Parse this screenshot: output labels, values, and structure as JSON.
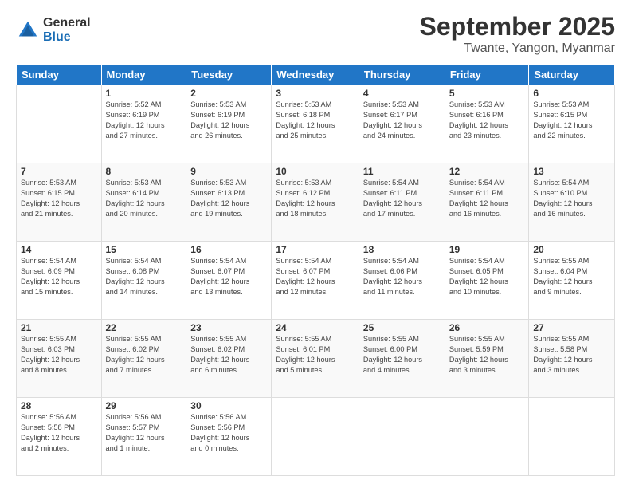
{
  "logo": {
    "general": "General",
    "blue": "Blue"
  },
  "header": {
    "title": "September 2025",
    "location": "Twante, Yangon, Myanmar"
  },
  "days_of_week": [
    "Sunday",
    "Monday",
    "Tuesday",
    "Wednesday",
    "Thursday",
    "Friday",
    "Saturday"
  ],
  "weeks": [
    [
      {
        "day": "",
        "info": ""
      },
      {
        "day": "1",
        "info": "Sunrise: 5:52 AM\nSunset: 6:19 PM\nDaylight: 12 hours\nand 27 minutes."
      },
      {
        "day": "2",
        "info": "Sunrise: 5:53 AM\nSunset: 6:19 PM\nDaylight: 12 hours\nand 26 minutes."
      },
      {
        "day": "3",
        "info": "Sunrise: 5:53 AM\nSunset: 6:18 PM\nDaylight: 12 hours\nand 25 minutes."
      },
      {
        "day": "4",
        "info": "Sunrise: 5:53 AM\nSunset: 6:17 PM\nDaylight: 12 hours\nand 24 minutes."
      },
      {
        "day": "5",
        "info": "Sunrise: 5:53 AM\nSunset: 6:16 PM\nDaylight: 12 hours\nand 23 minutes."
      },
      {
        "day": "6",
        "info": "Sunrise: 5:53 AM\nSunset: 6:15 PM\nDaylight: 12 hours\nand 22 minutes."
      }
    ],
    [
      {
        "day": "7",
        "info": "Sunrise: 5:53 AM\nSunset: 6:15 PM\nDaylight: 12 hours\nand 21 minutes."
      },
      {
        "day": "8",
        "info": "Sunrise: 5:53 AM\nSunset: 6:14 PM\nDaylight: 12 hours\nand 20 minutes."
      },
      {
        "day": "9",
        "info": "Sunrise: 5:53 AM\nSunset: 6:13 PM\nDaylight: 12 hours\nand 19 minutes."
      },
      {
        "day": "10",
        "info": "Sunrise: 5:53 AM\nSunset: 6:12 PM\nDaylight: 12 hours\nand 18 minutes."
      },
      {
        "day": "11",
        "info": "Sunrise: 5:54 AM\nSunset: 6:11 PM\nDaylight: 12 hours\nand 17 minutes."
      },
      {
        "day": "12",
        "info": "Sunrise: 5:54 AM\nSunset: 6:11 PM\nDaylight: 12 hours\nand 16 minutes."
      },
      {
        "day": "13",
        "info": "Sunrise: 5:54 AM\nSunset: 6:10 PM\nDaylight: 12 hours\nand 16 minutes."
      }
    ],
    [
      {
        "day": "14",
        "info": "Sunrise: 5:54 AM\nSunset: 6:09 PM\nDaylight: 12 hours\nand 15 minutes."
      },
      {
        "day": "15",
        "info": "Sunrise: 5:54 AM\nSunset: 6:08 PM\nDaylight: 12 hours\nand 14 minutes."
      },
      {
        "day": "16",
        "info": "Sunrise: 5:54 AM\nSunset: 6:07 PM\nDaylight: 12 hours\nand 13 minutes."
      },
      {
        "day": "17",
        "info": "Sunrise: 5:54 AM\nSunset: 6:07 PM\nDaylight: 12 hours\nand 12 minutes."
      },
      {
        "day": "18",
        "info": "Sunrise: 5:54 AM\nSunset: 6:06 PM\nDaylight: 12 hours\nand 11 minutes."
      },
      {
        "day": "19",
        "info": "Sunrise: 5:54 AM\nSunset: 6:05 PM\nDaylight: 12 hours\nand 10 minutes."
      },
      {
        "day": "20",
        "info": "Sunrise: 5:55 AM\nSunset: 6:04 PM\nDaylight: 12 hours\nand 9 minutes."
      }
    ],
    [
      {
        "day": "21",
        "info": "Sunrise: 5:55 AM\nSunset: 6:03 PM\nDaylight: 12 hours\nand 8 minutes."
      },
      {
        "day": "22",
        "info": "Sunrise: 5:55 AM\nSunset: 6:02 PM\nDaylight: 12 hours\nand 7 minutes."
      },
      {
        "day": "23",
        "info": "Sunrise: 5:55 AM\nSunset: 6:02 PM\nDaylight: 12 hours\nand 6 minutes."
      },
      {
        "day": "24",
        "info": "Sunrise: 5:55 AM\nSunset: 6:01 PM\nDaylight: 12 hours\nand 5 minutes."
      },
      {
        "day": "25",
        "info": "Sunrise: 5:55 AM\nSunset: 6:00 PM\nDaylight: 12 hours\nand 4 minutes."
      },
      {
        "day": "26",
        "info": "Sunrise: 5:55 AM\nSunset: 5:59 PM\nDaylight: 12 hours\nand 3 minutes."
      },
      {
        "day": "27",
        "info": "Sunrise: 5:55 AM\nSunset: 5:58 PM\nDaylight: 12 hours\nand 3 minutes."
      }
    ],
    [
      {
        "day": "28",
        "info": "Sunrise: 5:56 AM\nSunset: 5:58 PM\nDaylight: 12 hours\nand 2 minutes."
      },
      {
        "day": "29",
        "info": "Sunrise: 5:56 AM\nSunset: 5:57 PM\nDaylight: 12 hours\nand 1 minute."
      },
      {
        "day": "30",
        "info": "Sunrise: 5:56 AM\nSunset: 5:56 PM\nDaylight: 12 hours\nand 0 minutes."
      },
      {
        "day": "",
        "info": ""
      },
      {
        "day": "",
        "info": ""
      },
      {
        "day": "",
        "info": ""
      },
      {
        "day": "",
        "info": ""
      }
    ]
  ]
}
